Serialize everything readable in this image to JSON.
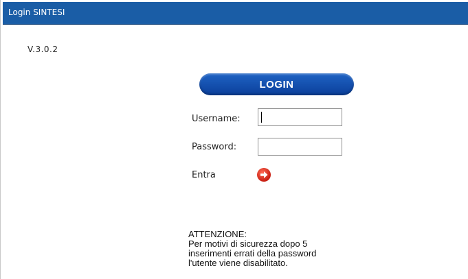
{
  "header": {
    "title": "Login SINTESI",
    "bg_color": "#1a5da6"
  },
  "version": "V.3.0.2",
  "login_banner": {
    "label": "LOGIN",
    "color": "#1f63c4"
  },
  "form": {
    "username_label": "Username:",
    "username_value": "",
    "password_label": "Password:",
    "password_value": "",
    "submit_label": "Entra",
    "submit_icon": "red-arrow-circle-icon"
  },
  "notice": {
    "heading": "ATTENZIONE:",
    "lines": [
      "Per motivi di sicurezza dopo 5",
      "inserimenti errati della password",
      "l'utente viene disabilitato."
    ]
  }
}
